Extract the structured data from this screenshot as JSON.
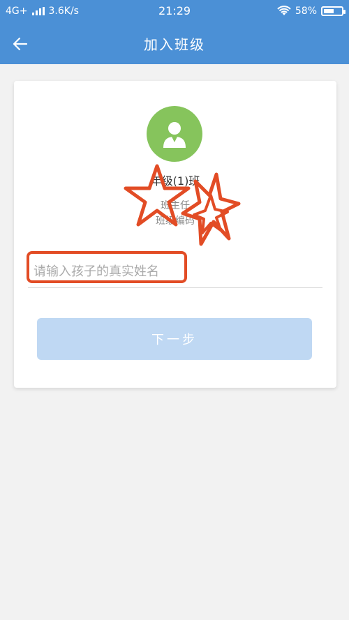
{
  "status_bar": {
    "network": "4G+",
    "speed": "3.6K/s",
    "time": "21:29",
    "battery": "58%",
    "battery_level": 0.58
  },
  "header": {
    "title": "加入班级"
  },
  "class_info": {
    "name": "年级(1)班",
    "teacher": "班主任",
    "code": "班级编码"
  },
  "form": {
    "child_name_placeholder": "请输入孩子的真实姓名",
    "child_name_value": ""
  },
  "actions": {
    "next_label": "下一步"
  },
  "colors": {
    "primary": "#4b90d6",
    "avatar_bg": "#86c45c",
    "highlight": "#e24c25",
    "button_disabled": "#bfd8f3"
  }
}
